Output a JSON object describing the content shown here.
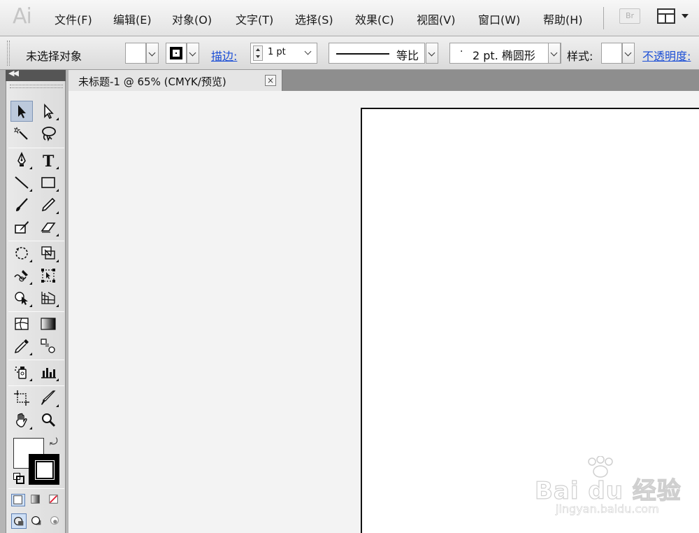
{
  "app": {
    "logo_text": "Ai"
  },
  "menubar": {
    "items": [
      "文件(F)",
      "编辑(E)",
      "对象(O)",
      "文字(T)",
      "选择(S)",
      "效果(C)",
      "视图(V)",
      "窗口(W)",
      "帮助(H)"
    ],
    "bridge_label": "Br"
  },
  "controlbar": {
    "selection_status": "未选择对象",
    "stroke_link": "描边:",
    "stroke_weight": "1 pt",
    "profile_label": "等比",
    "brush_dot": "·",
    "brush_label": "2 pt. 椭圆形",
    "style_label": "样式:",
    "opacity_link": "不透明度:"
  },
  "document": {
    "tab_title": "未标题-1 @ 65% (CMYK/预览)",
    "tab_close": "×"
  },
  "tools": {
    "names": [
      "selection-tool",
      "direct-selection-tool",
      "magic-wand-tool",
      "lasso-tool",
      "pen-tool",
      "type-tool",
      "line-segment-tool",
      "rectangle-tool",
      "paintbrush-tool",
      "pencil-tool",
      "blob-brush-tool",
      "eraser-tool",
      "rotate-tool",
      "scale-tool",
      "warp-tool",
      "free-transform-tool",
      "shape-builder-tool",
      "perspective-grid-tool",
      "mesh-tool",
      "gradient-tool",
      "eyedropper-tool",
      "blend-tool",
      "symbol-sprayer-tool",
      "column-graph-tool",
      "artboard-tool",
      "slice-tool",
      "hand-tool",
      "zoom-tool"
    ],
    "active": "selection-tool",
    "fill_color": "#ffffff",
    "stroke_color": "#000000"
  },
  "watermark": {
    "brand": "Bai du 经验",
    "url": "jingyan.baidu.com"
  },
  "colors": {
    "link_blue": "#1c4fd6",
    "canvas_bg": "#f3f3f3",
    "artboard": "#ffffff",
    "active_tool_bg": "#bcc9dc"
  }
}
